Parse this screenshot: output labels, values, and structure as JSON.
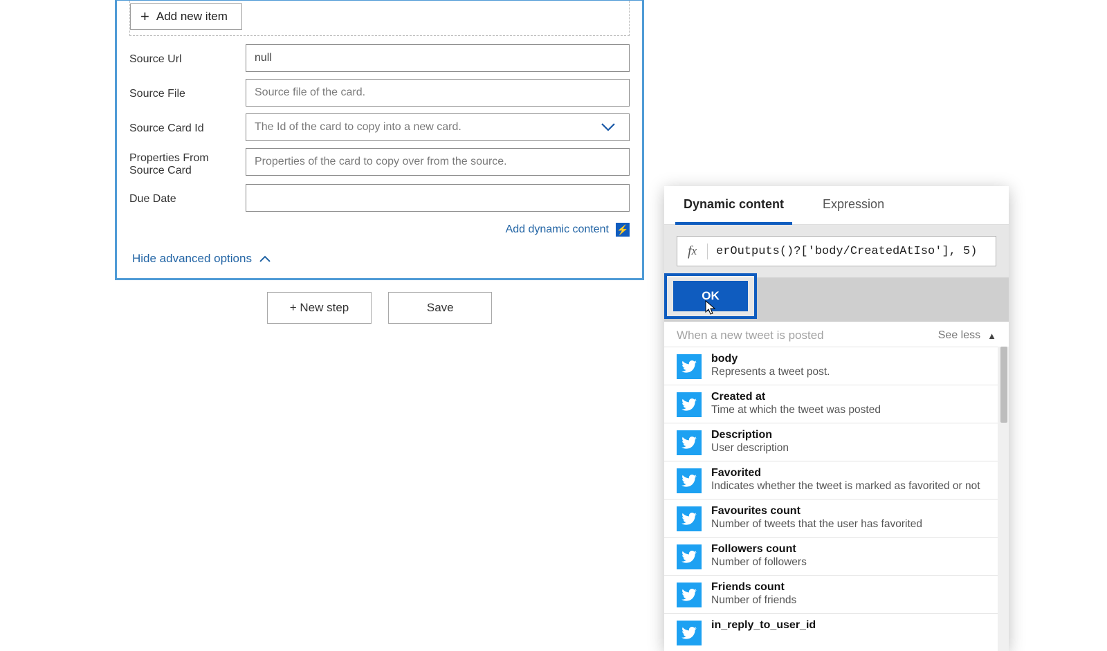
{
  "form": {
    "add_item_label": "Add new item",
    "fields": {
      "source_url": {
        "label": "Source Url",
        "value": "null"
      },
      "source_file": {
        "label": "Source File",
        "placeholder": "Source file of the card."
      },
      "source_card_id": {
        "label": "Source Card Id",
        "placeholder": "The Id of the card to copy into a new card."
      },
      "props_from_source": {
        "label": "Properties From Source Card",
        "placeholder": "Properties of the card to copy over from the source."
      },
      "due_date": {
        "label": "Due Date",
        "value": ""
      }
    },
    "add_dynamic_content": "Add dynamic content",
    "hide_advanced": "Hide advanced options"
  },
  "actions": {
    "new_step": "+ New step",
    "save": "Save"
  },
  "dc": {
    "tabs": {
      "dynamic": "Dynamic content",
      "expression": "Expression"
    },
    "fx_value": "erOutputs()?['body/CreatedAtIso'], 5)",
    "ok": "OK",
    "section_title": "When a new tweet is posted",
    "see_less": "See less",
    "items": [
      {
        "title": "body",
        "desc": "Represents a tweet post."
      },
      {
        "title": "Created at",
        "desc": "Time at which the tweet was posted"
      },
      {
        "title": "Description",
        "desc": "User description"
      },
      {
        "title": "Favorited",
        "desc": "Indicates whether the tweet is marked as favorited or not"
      },
      {
        "title": "Favourites count",
        "desc": "Number of tweets that the user has favorited"
      },
      {
        "title": "Followers count",
        "desc": "Number of followers"
      },
      {
        "title": "Friends count",
        "desc": "Number of friends"
      },
      {
        "title": "in_reply_to_user_id",
        "desc": ""
      }
    ]
  }
}
